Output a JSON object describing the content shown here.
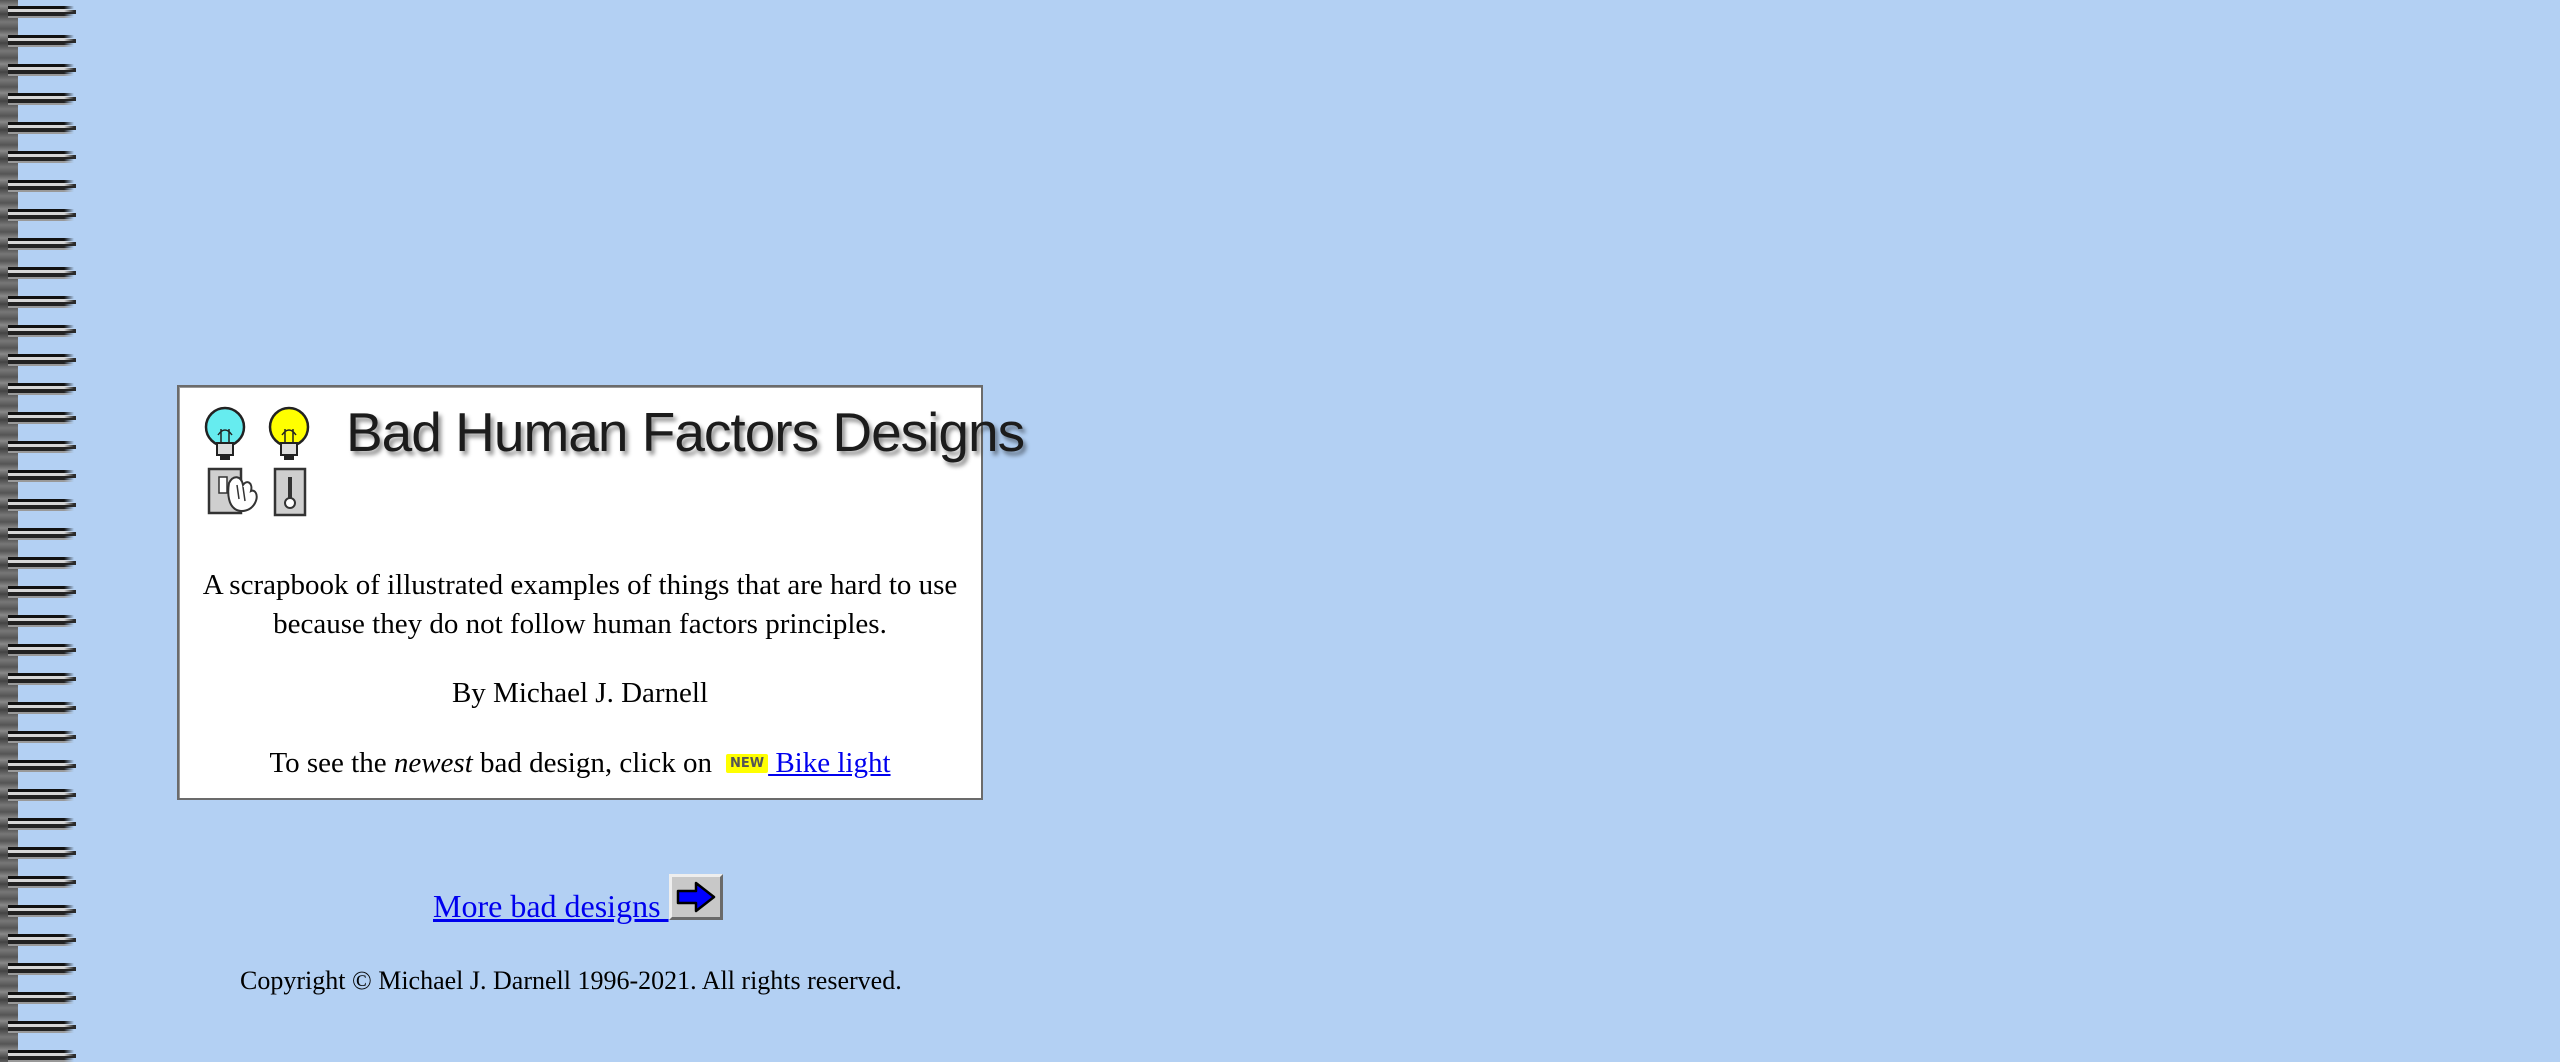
{
  "header": {
    "title": "Bad Human Factors Designs",
    "logo_icons": [
      "lightbulb-cyan-icon",
      "lightbulb-yellow-icon",
      "hand-switch-icon",
      "slider-switch-icon"
    ]
  },
  "main": {
    "tagline": "A scrapbook of illustrated examples of things that are hard to use because they do not follow human factors principles.",
    "byline": "By Michael J. Darnell",
    "newest": {
      "prefix": "To see the ",
      "emphasis": "newest",
      "suffix": " bad design, click on",
      "badge": "NEW",
      "link_text": " Bike light"
    }
  },
  "footer": {
    "more_link": "More bad designs ",
    "arrow_icon": "right-arrow-icon",
    "copyright": "Copyright © Michael J. Darnell 1996-2021. All rights reserved."
  },
  "colors": {
    "background": "#b3d0f3",
    "link": "#0000ee",
    "badge": "#ffff00",
    "arrow": "#0000ff"
  }
}
